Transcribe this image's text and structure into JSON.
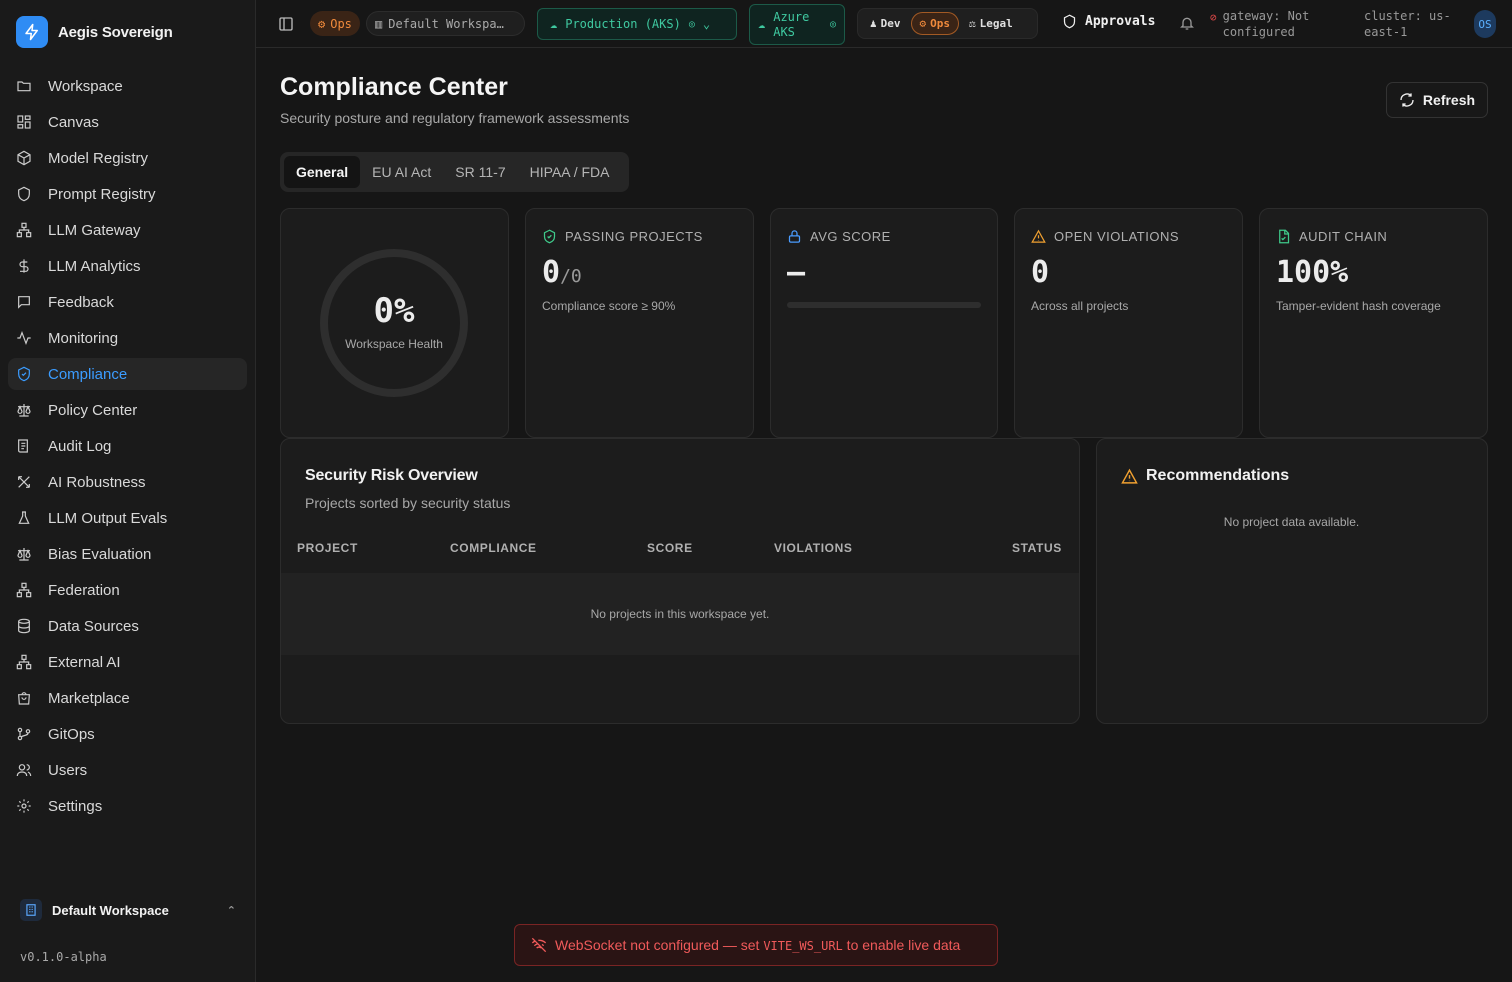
{
  "brand": {
    "name": "Aegis Sovereign",
    "accent": "#2f8cf4"
  },
  "sidebar": {
    "items": [
      {
        "label": "Workspace",
        "icon": "folder-icon"
      },
      {
        "label": "Canvas",
        "icon": "grid-icon"
      },
      {
        "label": "Model Registry",
        "icon": "cube-icon"
      },
      {
        "label": "Prompt Registry",
        "icon": "shield-icon"
      },
      {
        "label": "LLM Gateway",
        "icon": "network-icon"
      },
      {
        "label": "LLM Analytics",
        "icon": "dollar-icon"
      },
      {
        "label": "Feedback",
        "icon": "message-icon"
      },
      {
        "label": "Monitoring",
        "icon": "activity-icon"
      },
      {
        "label": "Compliance",
        "icon": "shield-check-icon",
        "active": true
      },
      {
        "label": "Policy Center",
        "icon": "scale-icon"
      },
      {
        "label": "Audit Log",
        "icon": "log-icon"
      },
      {
        "label": "AI Robustness",
        "icon": "robustness-icon"
      },
      {
        "label": "LLM Output Evals",
        "icon": "flask-icon"
      },
      {
        "label": "Bias Evaluation",
        "icon": "scale-icon"
      },
      {
        "label": "Federation",
        "icon": "network-icon"
      },
      {
        "label": "Data Sources",
        "icon": "database-icon"
      },
      {
        "label": "External AI",
        "icon": "network-icon"
      },
      {
        "label": "Marketplace",
        "icon": "bag-icon"
      },
      {
        "label": "GitOps",
        "icon": "git-icon"
      },
      {
        "label": "Users",
        "icon": "users-icon"
      },
      {
        "label": "Settings",
        "icon": "gear-icon"
      }
    ],
    "workspace": "Default Workspace",
    "version": "v0.1.0-alpha"
  },
  "topbar": {
    "ops_pill": "Ops",
    "workspace_pill": "Default Workspa…",
    "environment": "Production (AKS)",
    "cluster_provider_line1": "Azure",
    "cluster_provider_line2": "AKS",
    "personas": [
      "Dev",
      "Ops",
      "Legal"
    ],
    "active_persona": "Ops",
    "approvals": "Approvals",
    "gateway_line1": "gateway: Not",
    "gateway_line2": "configured",
    "cluster_line1": "cluster: us-",
    "cluster_line2": "east-1",
    "avatar": "OS"
  },
  "page": {
    "title": "Compliance Center",
    "subtitle": "Security posture and regulatory framework assessments",
    "refresh": "Refresh",
    "tabs": [
      "General",
      "EU AI Act",
      "SR 11-7",
      "HIPAA / FDA"
    ],
    "active_tab": "General"
  },
  "stats": {
    "health": {
      "value": "0%",
      "label": "Workspace Health",
      "progress": 0
    },
    "passing": {
      "label": "PASSING PROJECTS",
      "value": "0",
      "total": "/0",
      "note": "Compliance score ≥ 90%",
      "color": "#3fc98a"
    },
    "avg": {
      "label": "AVG SCORE",
      "value": "—",
      "progress": 0,
      "color": "#4a9cff"
    },
    "violations": {
      "label": "OPEN VIOLATIONS",
      "value": "0",
      "note": "Across all projects",
      "color": "#f0a030"
    },
    "audit": {
      "label": "AUDIT CHAIN",
      "value": "100%",
      "note": "Tamper-evident hash coverage",
      "color": "#3fc98a"
    }
  },
  "risk": {
    "title": "Security Risk Overview",
    "subtitle": "Projects sorted by security status",
    "columns": [
      "PROJECT",
      "COMPLIANCE",
      "SCORE",
      "VIOLATIONS",
      "STATUS"
    ],
    "empty": "No projects in this workspace yet."
  },
  "recommendations": {
    "title": "Recommendations",
    "empty": "No project data available."
  },
  "banner": {
    "prefix": "WebSocket not configured — set ",
    "code": "VITE_WS_URL",
    "suffix": " to enable live data"
  }
}
